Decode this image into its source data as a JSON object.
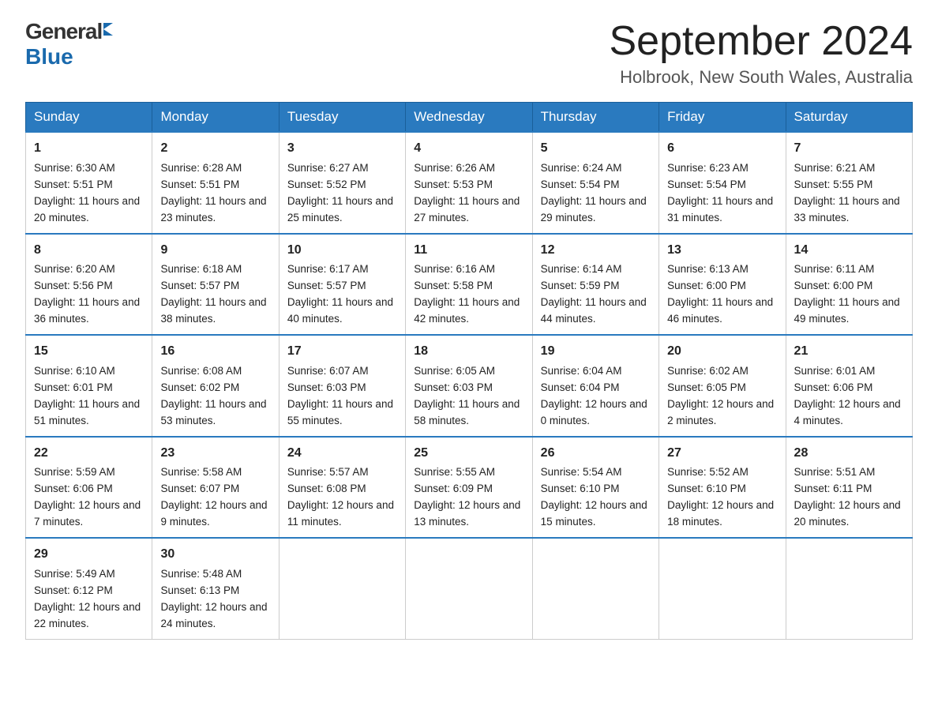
{
  "header": {
    "logo_general": "General",
    "logo_blue": "Blue",
    "month_title": "September 2024",
    "location": "Holbrook, New South Wales, Australia"
  },
  "days_of_week": [
    "Sunday",
    "Monday",
    "Tuesday",
    "Wednesday",
    "Thursday",
    "Friday",
    "Saturday"
  ],
  "weeks": [
    [
      {
        "date": "1",
        "sunrise": "6:30 AM",
        "sunset": "5:51 PM",
        "daylight": "11 hours and 20 minutes."
      },
      {
        "date": "2",
        "sunrise": "6:28 AM",
        "sunset": "5:51 PM",
        "daylight": "11 hours and 23 minutes."
      },
      {
        "date": "3",
        "sunrise": "6:27 AM",
        "sunset": "5:52 PM",
        "daylight": "11 hours and 25 minutes."
      },
      {
        "date": "4",
        "sunrise": "6:26 AM",
        "sunset": "5:53 PM",
        "daylight": "11 hours and 27 minutes."
      },
      {
        "date": "5",
        "sunrise": "6:24 AM",
        "sunset": "5:54 PM",
        "daylight": "11 hours and 29 minutes."
      },
      {
        "date": "6",
        "sunrise": "6:23 AM",
        "sunset": "5:54 PM",
        "daylight": "11 hours and 31 minutes."
      },
      {
        "date": "7",
        "sunrise": "6:21 AM",
        "sunset": "5:55 PM",
        "daylight": "11 hours and 33 minutes."
      }
    ],
    [
      {
        "date": "8",
        "sunrise": "6:20 AM",
        "sunset": "5:56 PM",
        "daylight": "11 hours and 36 minutes."
      },
      {
        "date": "9",
        "sunrise": "6:18 AM",
        "sunset": "5:57 PM",
        "daylight": "11 hours and 38 minutes."
      },
      {
        "date": "10",
        "sunrise": "6:17 AM",
        "sunset": "5:57 PM",
        "daylight": "11 hours and 40 minutes."
      },
      {
        "date": "11",
        "sunrise": "6:16 AM",
        "sunset": "5:58 PM",
        "daylight": "11 hours and 42 minutes."
      },
      {
        "date": "12",
        "sunrise": "6:14 AM",
        "sunset": "5:59 PM",
        "daylight": "11 hours and 44 minutes."
      },
      {
        "date": "13",
        "sunrise": "6:13 AM",
        "sunset": "6:00 PM",
        "daylight": "11 hours and 46 minutes."
      },
      {
        "date": "14",
        "sunrise": "6:11 AM",
        "sunset": "6:00 PM",
        "daylight": "11 hours and 49 minutes."
      }
    ],
    [
      {
        "date": "15",
        "sunrise": "6:10 AM",
        "sunset": "6:01 PM",
        "daylight": "11 hours and 51 minutes."
      },
      {
        "date": "16",
        "sunrise": "6:08 AM",
        "sunset": "6:02 PM",
        "daylight": "11 hours and 53 minutes."
      },
      {
        "date": "17",
        "sunrise": "6:07 AM",
        "sunset": "6:03 PM",
        "daylight": "11 hours and 55 minutes."
      },
      {
        "date": "18",
        "sunrise": "6:05 AM",
        "sunset": "6:03 PM",
        "daylight": "11 hours and 58 minutes."
      },
      {
        "date": "19",
        "sunrise": "6:04 AM",
        "sunset": "6:04 PM",
        "daylight": "12 hours and 0 minutes."
      },
      {
        "date": "20",
        "sunrise": "6:02 AM",
        "sunset": "6:05 PM",
        "daylight": "12 hours and 2 minutes."
      },
      {
        "date": "21",
        "sunrise": "6:01 AM",
        "sunset": "6:06 PM",
        "daylight": "12 hours and 4 minutes."
      }
    ],
    [
      {
        "date": "22",
        "sunrise": "5:59 AM",
        "sunset": "6:06 PM",
        "daylight": "12 hours and 7 minutes."
      },
      {
        "date": "23",
        "sunrise": "5:58 AM",
        "sunset": "6:07 PM",
        "daylight": "12 hours and 9 minutes."
      },
      {
        "date": "24",
        "sunrise": "5:57 AM",
        "sunset": "6:08 PM",
        "daylight": "12 hours and 11 minutes."
      },
      {
        "date": "25",
        "sunrise": "5:55 AM",
        "sunset": "6:09 PM",
        "daylight": "12 hours and 13 minutes."
      },
      {
        "date": "26",
        "sunrise": "5:54 AM",
        "sunset": "6:10 PM",
        "daylight": "12 hours and 15 minutes."
      },
      {
        "date": "27",
        "sunrise": "5:52 AM",
        "sunset": "6:10 PM",
        "daylight": "12 hours and 18 minutes."
      },
      {
        "date": "28",
        "sunrise": "5:51 AM",
        "sunset": "6:11 PM",
        "daylight": "12 hours and 20 minutes."
      }
    ],
    [
      {
        "date": "29",
        "sunrise": "5:49 AM",
        "sunset": "6:12 PM",
        "daylight": "12 hours and 22 minutes."
      },
      {
        "date": "30",
        "sunrise": "5:48 AM",
        "sunset": "6:13 PM",
        "daylight": "12 hours and 24 minutes."
      },
      null,
      null,
      null,
      null,
      null
    ]
  ],
  "labels": {
    "sunrise": "Sunrise:",
    "sunset": "Sunset:",
    "daylight": "Daylight:"
  }
}
